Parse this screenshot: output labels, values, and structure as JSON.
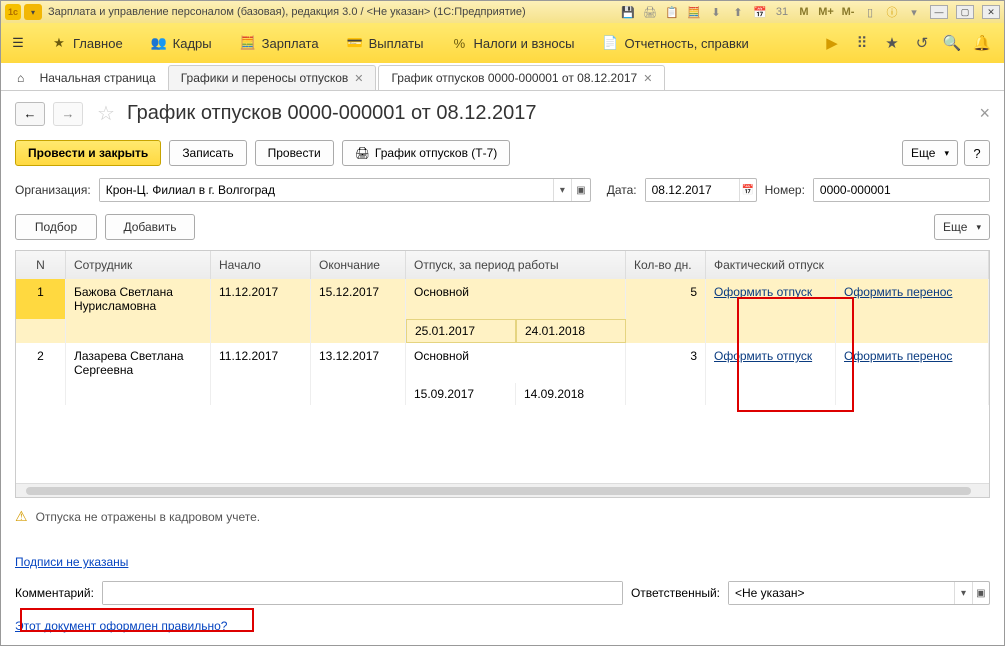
{
  "titlebar": {
    "title": "Зарплата и управление персоналом (базовая), редакция 3.0 / <Не указан> (1С:Предприятие)",
    "m1": "M",
    "m2": "M+",
    "m3": "M-"
  },
  "menu": {
    "main": "Главное",
    "kadry": "Кадры",
    "zp": "Зарплата",
    "vyp": "Выплаты",
    "nalogi": "Налоги и взносы",
    "otch": "Отчетность, справки"
  },
  "tabs": {
    "home": "Начальная страница",
    "t1": "Графики и переносы отпусков",
    "t2": "График отпусков 0000-000001 от 08.12.2017"
  },
  "page": {
    "title": "График отпусков 0000-000001 от 08.12.2017",
    "back": "←",
    "fwd": "→"
  },
  "toolbar": {
    "post_close": "Провести и закрыть",
    "save": "Записать",
    "post": "Провести",
    "print": "График отпусков (Т-7)",
    "more": "Еще",
    "help": "?"
  },
  "form": {
    "org_lbl": "Организация:",
    "org_val": "Крон-Ц. Филиал в г. Волгоград",
    "date_lbl": "Дата:",
    "date_val": "08.12.2017",
    "num_lbl": "Номер:",
    "num_val": "0000-000001",
    "select": "Подбор",
    "add": "Добавить",
    "more": "Еще"
  },
  "cols": {
    "n": "N",
    "emp": "Сотрудник",
    "start": "Начало",
    "end": "Окончание",
    "otp": "Отпуск, за период работы",
    "days": "Кол-во дн.",
    "act": "Фактический отпуск"
  },
  "rows": [
    {
      "n": "1",
      "emp": "Бажова Светлана Нурисламовна",
      "start": "11.12.2017",
      "end": "15.12.2017",
      "otp": "Основной",
      "days": "5",
      "p1": "25.01.2017",
      "p2": "24.01.2018",
      "a1": "Оформить отпуск",
      "a2": "Оформить перенос"
    },
    {
      "n": "2",
      "emp": "Лазарева Светлана Сергеевна",
      "start": "11.12.2017",
      "end": "13.12.2017",
      "otp": "Основной",
      "days": "3",
      "p1": "15.09.2017",
      "p2": "14.09.2018",
      "a1": "Оформить отпуск",
      "a2": "Оформить перенос"
    }
  ],
  "warn": "Отпуска не отражены в кадровом учете.",
  "sign": "Подписи не указаны",
  "comment_lbl": "Комментарий:",
  "resp_lbl": "Ответственный:",
  "resp_val": "<Не указан>",
  "feedback": "Этот документ оформлен правильно?"
}
